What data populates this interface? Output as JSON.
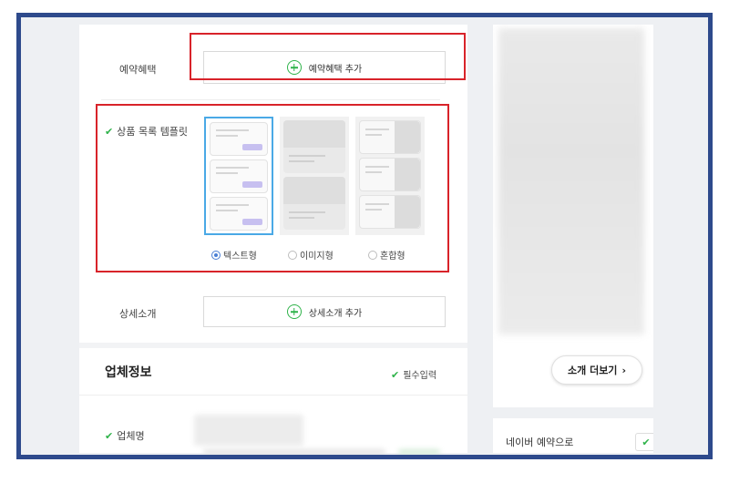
{
  "benefit": {
    "label": "예약혜택",
    "add_button": "예약혜택 추가"
  },
  "template": {
    "label": "상품 목록 템플릿",
    "options": [
      {
        "label": "텍스트형",
        "selected": true
      },
      {
        "label": "이미지형",
        "selected": false
      },
      {
        "label": "혼합형",
        "selected": false
      }
    ]
  },
  "detail": {
    "label": "상세소개",
    "add_button": "상세소개 추가"
  },
  "company": {
    "title": "업체정보",
    "required": "필수입력",
    "name_label": "업체명"
  },
  "sidebar": {
    "more_button": "소개 더보기",
    "naver_text": "네이버 예약으로"
  },
  "colors": {
    "highlight": "#d8232a",
    "accent_green": "#2fb34a",
    "frame": "#2e4a8c",
    "selected_border": "#4aa9e6"
  }
}
